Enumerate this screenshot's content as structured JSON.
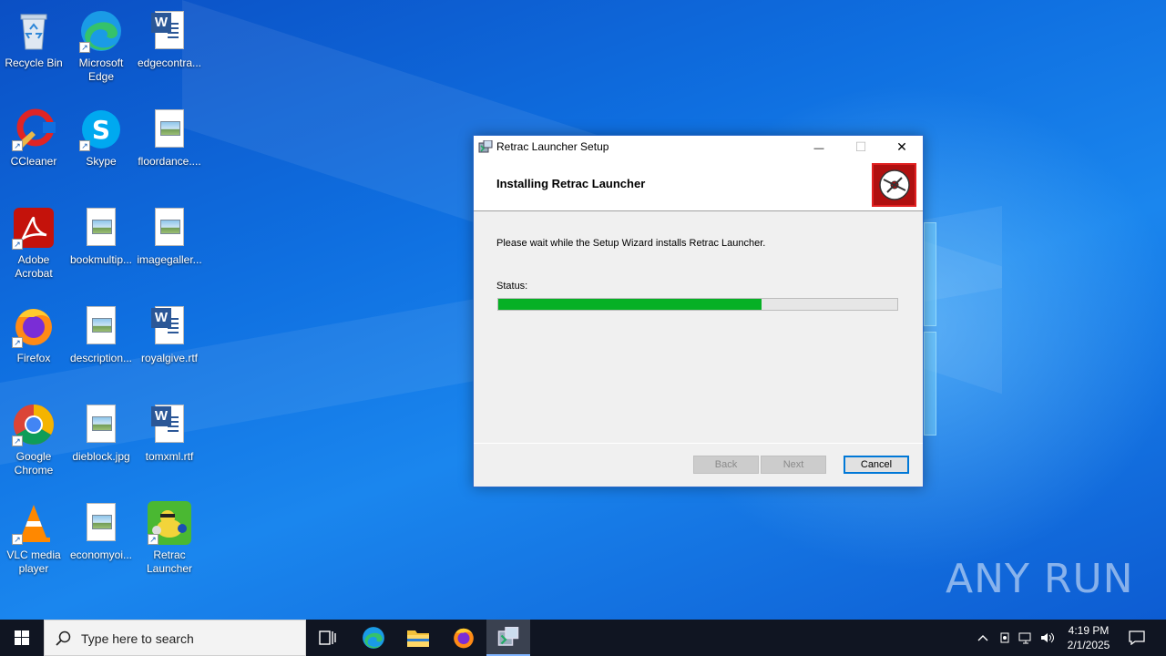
{
  "desktop": {
    "icons": [
      {
        "label": "Recycle Bin",
        "icon": "recycle-bin-icon"
      },
      {
        "label": "Microsoft Edge",
        "icon": "edge-icon"
      },
      {
        "label": "edgecontra...",
        "icon": "word-document-icon"
      },
      {
        "label": "CCleaner",
        "icon": "ccleaner-icon"
      },
      {
        "label": "Skype",
        "icon": "skype-icon"
      },
      {
        "label": "floordance....",
        "icon": "image-file-icon"
      },
      {
        "label": "Adobe Acrobat",
        "icon": "acrobat-icon"
      },
      {
        "label": "bookmultip...",
        "icon": "image-file-icon"
      },
      {
        "label": "imagegaller...",
        "icon": "image-file-icon"
      },
      {
        "label": "Firefox",
        "icon": "firefox-icon"
      },
      {
        "label": "description...",
        "icon": "image-file-icon"
      },
      {
        "label": "royalgive.rtf",
        "icon": "word-document-icon"
      },
      {
        "label": "Google Chrome",
        "icon": "chrome-icon"
      },
      {
        "label": "dieblock.jpg",
        "icon": "image-file-icon"
      },
      {
        "label": "tomxml.rtf",
        "icon": "word-document-icon"
      },
      {
        "label": "VLC media player",
        "icon": "vlc-icon"
      },
      {
        "label": "economyoi...",
        "icon": "image-file-icon"
      },
      {
        "label": "Retrac Launcher",
        "icon": "retrac-launcher-icon"
      }
    ],
    "watermark": "ANY RUN"
  },
  "dialog": {
    "title": "Retrac Launcher Setup",
    "heading": "Installing Retrac Launcher",
    "message": "Please wait while the Setup Wizard installs Retrac Launcher.",
    "status_label": "Status:",
    "progress": 0.66,
    "buttons": {
      "back": "Back",
      "next": "Next",
      "cancel": "Cancel"
    },
    "controls": {
      "minimize": "—",
      "maximize": "☐",
      "close": "✕"
    }
  },
  "taskbar": {
    "search_placeholder": "Type here to search",
    "apps": [
      "task-view-icon",
      "edge-icon",
      "file-explorer-icon",
      "firefox-icon",
      "installer-icon"
    ],
    "clock": {
      "time": "4:19 PM",
      "date": "2/1/2025"
    }
  },
  "colors": {
    "progress_fill": "#06b025",
    "desktop_blue": "#0f6fe0",
    "taskbar": "#101522"
  }
}
